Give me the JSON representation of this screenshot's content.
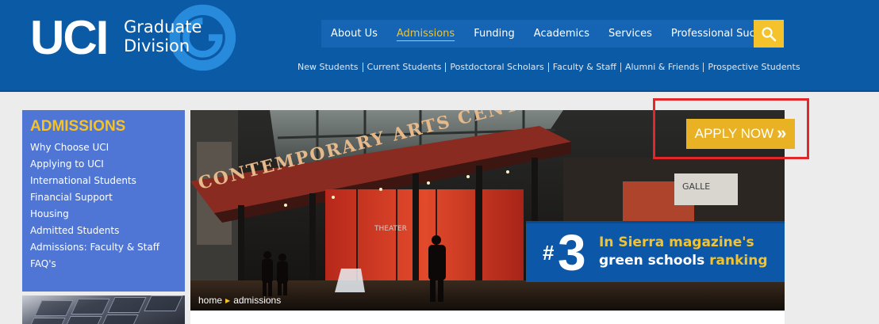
{
  "logo": {
    "abbr": "UCI",
    "line1": "Graduate",
    "line2": "Division"
  },
  "main_nav": [
    {
      "label": "About Us",
      "active": false
    },
    {
      "label": "Admissions",
      "active": true
    },
    {
      "label": "Funding",
      "active": false
    },
    {
      "label": "Academics",
      "active": false
    },
    {
      "label": "Services",
      "active": false
    },
    {
      "label": "Professional Success",
      "active": false
    }
  ],
  "search": {
    "icon": "search-icon"
  },
  "sub_nav": [
    "New Students",
    "Current Students",
    "Postdoctoral Scholars",
    "Faculty & Staff",
    "Alumni & Friends",
    "Prospective Students"
  ],
  "sidebar": {
    "title": "ADMISSIONS",
    "items": [
      "Why Choose UCI",
      "Applying to UCI",
      "International Students",
      "Financial Support",
      "Housing",
      "Admitted Students",
      "Admissions: Faculty & Staff",
      "FAQ's"
    ]
  },
  "hero": {
    "sign_upper": "CONTEMPORARY ARTS CENTER",
    "sign_theater": "THEATER",
    "sign_gallery": "GALLE",
    "apply_label": "APPLY NOW",
    "apply_chevron": "»",
    "banner": {
      "hash": "#",
      "number": "3",
      "line1": "In Sierra magazine's",
      "line2_main": "green schools",
      "line2_highlight": "ranking"
    }
  },
  "breadcrumb": {
    "home": "home",
    "current": "admissions"
  },
  "colors": {
    "brand_blue": "#0a5aa5",
    "accent_gold": "#f4c22a",
    "sidebar_blue": "#4f76d4",
    "highlight_red": "#e3262a"
  }
}
